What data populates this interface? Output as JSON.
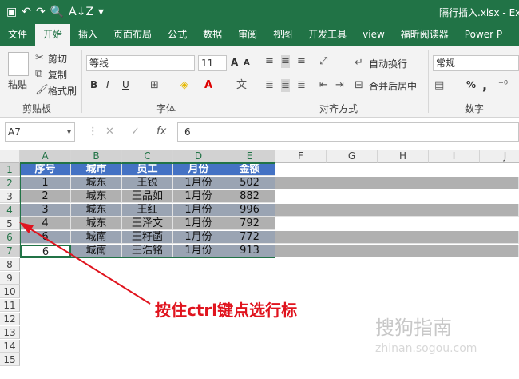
{
  "window": {
    "title": "隔行插入.xlsx - Exc"
  },
  "qat": {
    "save": "▣",
    "undo": "↶",
    "redo": "↷",
    "print": "🔍",
    "sort": "A↓Z",
    "more": "▾"
  },
  "tabs": [
    "文件",
    "开始",
    "插入",
    "页面布局",
    "公式",
    "数据",
    "审阅",
    "视图",
    "开发工具",
    "view",
    "福昕阅读器",
    "Power P"
  ],
  "active_tab": "开始",
  "ribbon": {
    "clipboard": {
      "paste": "粘贴",
      "cut": "剪切",
      "copy": "复制",
      "format_painter": "格式刷",
      "label": "剪贴板"
    },
    "font": {
      "name": "等线",
      "size": "11",
      "bold": "B",
      "italic": "I",
      "underline": "U",
      "grow": "A",
      "shrink": "A",
      "label": "字体"
    },
    "alignment": {
      "wrap": "自动换行",
      "merge": "合并后居中",
      "label": "对齐方式"
    },
    "number": {
      "format": "常规",
      "percent": "%",
      "comma": ",",
      "label": "数字"
    }
  },
  "formula_bar": {
    "name_box": "A7",
    "value": "6",
    "fx": "fx"
  },
  "columns": [
    "A",
    "B",
    "C",
    "D",
    "E",
    "F",
    "G",
    "H",
    "I",
    "J"
  ],
  "rows": [
    "1",
    "2",
    "3",
    "4",
    "5",
    "6",
    "7",
    "8",
    "9",
    "10",
    "11",
    "12",
    "13",
    "14",
    "15"
  ],
  "table": {
    "headers": [
      "序号",
      "城市",
      "员工",
      "月份",
      "金额"
    ],
    "rows": [
      [
        "1",
        "城东",
        "王锐",
        "1月份",
        "502"
      ],
      [
        "2",
        "城东",
        "王品如",
        "1月份",
        "882"
      ],
      [
        "3",
        "城东",
        "王红",
        "1月份",
        "996"
      ],
      [
        "4",
        "城东",
        "王泽文",
        "1月份",
        "792"
      ],
      [
        "6",
        "城南",
        "王籽菡",
        "1月份",
        "772"
      ],
      [
        "6",
        "城南",
        "王浩铭",
        "1月份",
        "913"
      ]
    ]
  },
  "annotation": "按住ctrl键点选行标",
  "watermark": {
    "text": "搜狗指南",
    "url": "zhinan.sogou.com"
  }
}
